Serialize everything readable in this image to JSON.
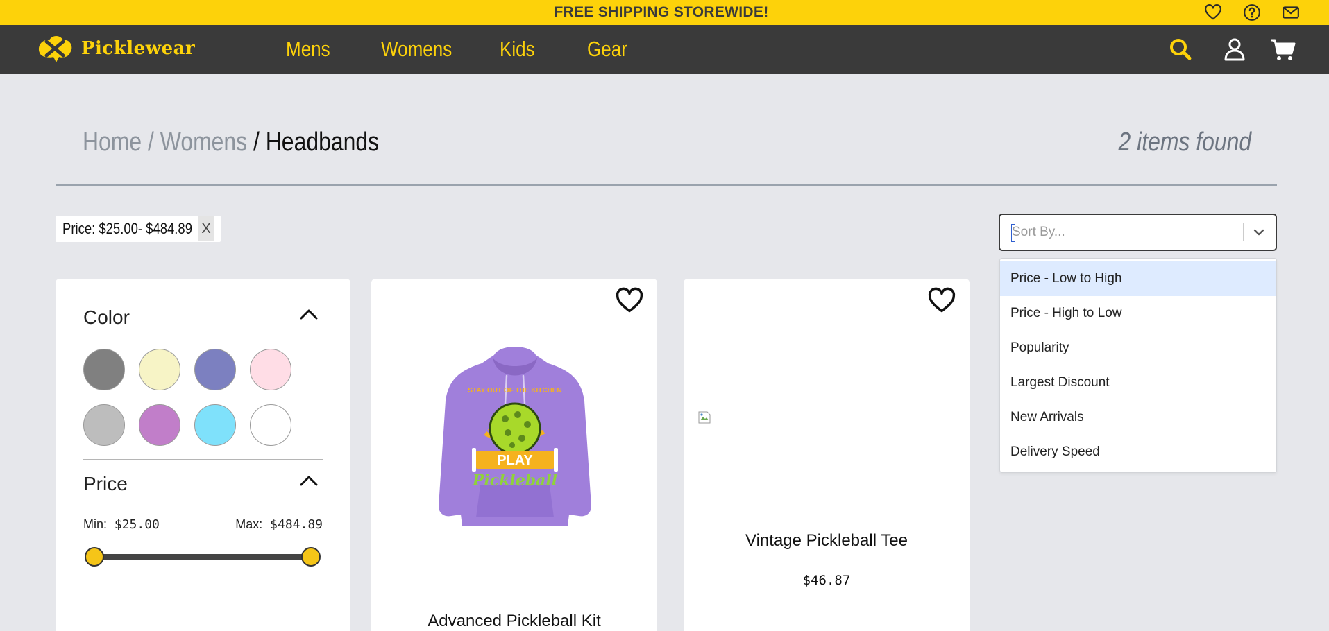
{
  "promo": {
    "text": "FREE SHIPPING STOREWIDE!",
    "icons": [
      "heart-icon",
      "help-icon",
      "mail-icon"
    ]
  },
  "brand": {
    "name": "Picklewear",
    "accent": "#fdd20a",
    "nav_bg": "#3a3a3a"
  },
  "nav": {
    "items": [
      "Mens",
      "Womens",
      "Kids",
      "Gear"
    ],
    "icons": [
      "search-icon",
      "user-icon",
      "cart-icon"
    ]
  },
  "breadcrumb": {
    "home": "Home",
    "sep1": "/",
    "parent": "Womens",
    "sep2": "/",
    "current": "Headbands"
  },
  "results": {
    "count_text": "2 items found"
  },
  "active_filter": {
    "label": "Price: $25.00- $484.89",
    "remove": "X"
  },
  "sort": {
    "placeholder": "Sort By...",
    "options": [
      "Price - Low to High",
      "Price - High to Low",
      "Popularity",
      "Largest Discount",
      "New Arrivals",
      "Delivery Speed"
    ],
    "highlighted": "Price - Low to High"
  },
  "filters": {
    "color": {
      "title": "Color",
      "swatches": [
        "#808080",
        "#f7f4c6",
        "#7c80c0",
        "#ffdde6",
        "#bdbdbd",
        "#c17ec9",
        "#7fe1fb",
        "#ffffff"
      ]
    },
    "price": {
      "title": "Price",
      "min_label": "Min:",
      "min_value": "$25.00",
      "max_label": "Max:",
      "max_value": "$484.89",
      "range_min_fraction": 0,
      "range_max_fraction": 1
    }
  },
  "products": [
    {
      "title": "Advanced Pickleball Kit",
      "price": "",
      "image": "purple hoodie with PLAY Pickleball graphic"
    },
    {
      "title": "Vintage Pickleball Tee",
      "price": "$46.87",
      "image": "broken image"
    }
  ],
  "hoodie": {
    "arc": "STAY OUT OF THE KITCHEN",
    "banner": "PLAY",
    "script": "Pickleball"
  }
}
